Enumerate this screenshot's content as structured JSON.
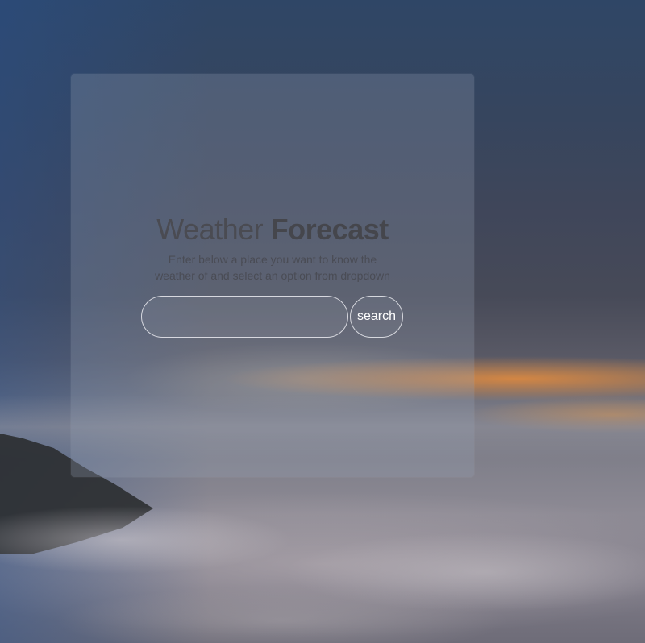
{
  "header": {
    "title_light": "Weather ",
    "title_bold": "Forecast",
    "subtitle_line1": "Enter below a place you want to know the",
    "subtitle_line2": "weather of and select an option from dropdown"
  },
  "search": {
    "value": "",
    "placeholder": "",
    "button_label": "search"
  },
  "colors": {
    "title": "#45464d",
    "subtitle": "#4a4c55",
    "control_border": "#ebebf0",
    "button_text": "#ffffff"
  }
}
